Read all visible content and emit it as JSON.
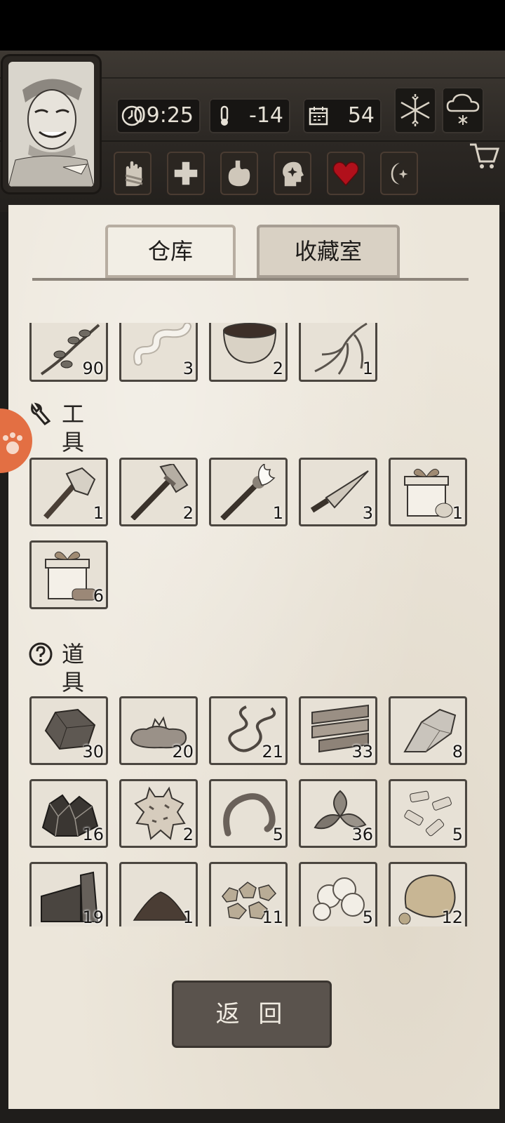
{
  "hud": {
    "time": "09:25",
    "temperature": "-14",
    "day": "54"
  },
  "tabs": {
    "warehouse": "仓库",
    "collection": "收藏室"
  },
  "sections": {
    "tools_title": "工具",
    "items_title": "道具"
  },
  "materials_row": [
    {
      "icon": "herb-branch-icon",
      "count": "90"
    },
    {
      "icon": "bandage-icon",
      "count": "3"
    },
    {
      "icon": "bowl-icon",
      "count": "2"
    },
    {
      "icon": "root-icon",
      "count": "1"
    }
  ],
  "tools": [
    {
      "icon": "stone-axe-icon",
      "count": "1"
    },
    {
      "icon": "stone-hammer-icon",
      "count": "2"
    },
    {
      "icon": "torch-icon",
      "count": "1"
    },
    {
      "icon": "spear-tip-icon",
      "count": "3"
    },
    {
      "icon": "gift-box-food-icon",
      "count": "1"
    },
    {
      "icon": "gift-box-wood-icon",
      "count": "6"
    }
  ],
  "items": [
    {
      "icon": "stone-icon",
      "count": "30"
    },
    {
      "icon": "water-puddle-icon",
      "count": "20"
    },
    {
      "icon": "worm-icon",
      "count": "21"
    },
    {
      "icon": "wood-planks-icon",
      "count": "33"
    },
    {
      "icon": "flint-icon",
      "count": "8"
    },
    {
      "icon": "ore-icon",
      "count": "16"
    },
    {
      "icon": "animal-hide-icon",
      "count": "2"
    },
    {
      "icon": "rope-icon",
      "count": "5"
    },
    {
      "icon": "leaves-icon",
      "count": "36"
    },
    {
      "icon": "bone-fragments-icon",
      "count": "5"
    },
    {
      "icon": "metal-scrap-icon",
      "count": "19"
    },
    {
      "icon": "soil-pile-icon",
      "count": "1"
    },
    {
      "icon": "gold-nuggets-icon",
      "count": "11"
    },
    {
      "icon": "cotton-icon",
      "count": "5"
    },
    {
      "icon": "sponge-rock-icon",
      "count": "12"
    }
  ],
  "back_button": "返 回",
  "colors": {
    "panel": "#ece6da",
    "frame": "#2c2824",
    "heart": "#b1101b",
    "orange_tab": "#e36f43"
  }
}
